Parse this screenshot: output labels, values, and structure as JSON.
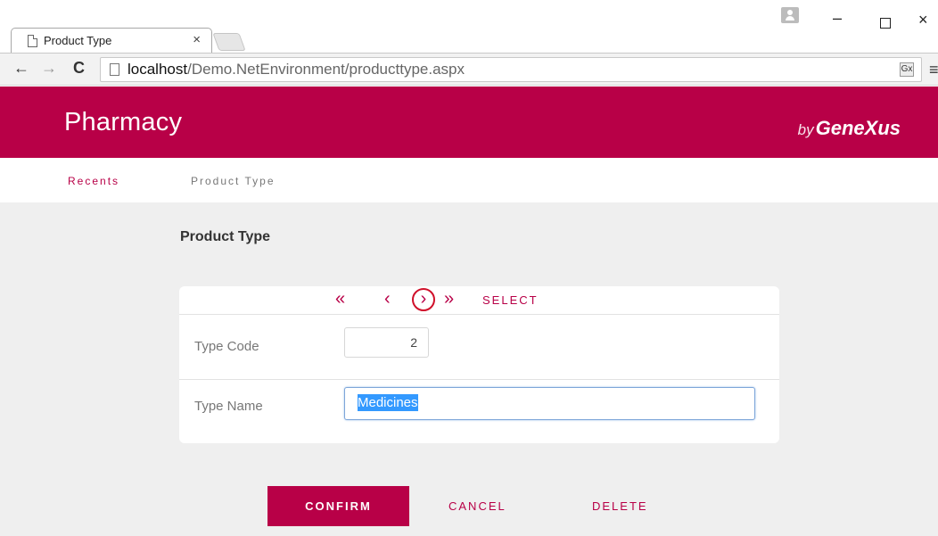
{
  "browser": {
    "tab_title": "Product Type",
    "tab_close": "×",
    "url_host": "localhost",
    "url_path": "/Demo.NetEnvironment/producttype.aspx",
    "window_minimize": "–",
    "window_close": "×",
    "nav_back": "←",
    "nav_forward": "→",
    "nav_reload": "C",
    "menu": "≡",
    "translate": "Gx"
  },
  "header": {
    "app_title": "Pharmacy",
    "brand_by": "by",
    "brand_name": "GeneXus",
    "background": "#b80047"
  },
  "menubar": {
    "items": [
      {
        "label": "Recents"
      },
      {
        "label": "Product Type"
      }
    ]
  },
  "main": {
    "page_title": "Product Type",
    "nav": {
      "first": "«",
      "prev": "‹",
      "next": "›",
      "last": "»",
      "select": "SELECT"
    },
    "fields": [
      {
        "label": "Type Code",
        "value": "2"
      },
      {
        "label": "Type Name",
        "value": "Medicines"
      }
    ],
    "buttons": {
      "confirm": "CONFIRM",
      "cancel": "CANCEL",
      "delete": "DELETE"
    }
  }
}
